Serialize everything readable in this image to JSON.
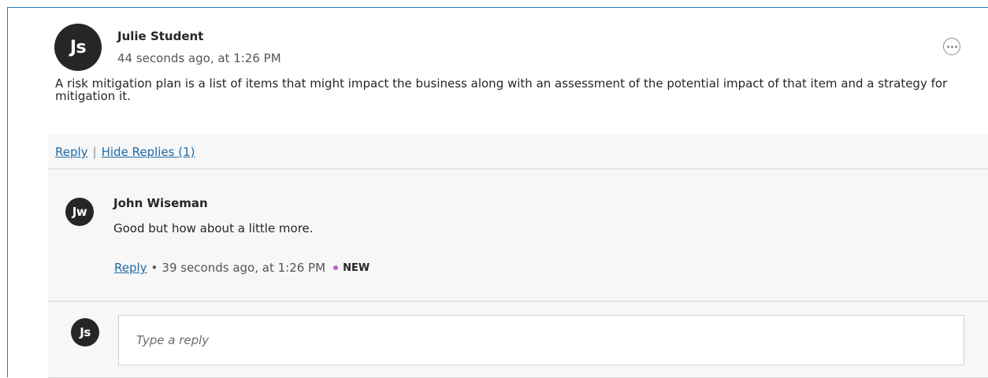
{
  "post": {
    "avatar_initials": "Js",
    "author": "Julie Student",
    "timestamp": "44 seconds ago, at 1:26 PM",
    "body": "A risk mitigation plan is a list of items that might impact the business along with an assessment of the potential impact of that item and a strategy for mitigation it."
  },
  "actions": {
    "reply_label": "Reply",
    "separator": "|",
    "hide_replies_label": "Hide Replies (1)"
  },
  "reply": {
    "avatar_initials": "Jw",
    "author": "John Wiseman",
    "body": "Good but how about a little more.",
    "reply_label": "Reply",
    "bullet": "•",
    "timestamp": "39 seconds ago, at 1:26 PM",
    "new_badge": "NEW"
  },
  "composer": {
    "avatar_initials": "Js",
    "placeholder": "Type a reply"
  },
  "icons": {
    "more": "more-options-icon"
  },
  "colors": {
    "link": "#1f6ba8",
    "frame_border": "#2a77b6",
    "new_dot": "#c25fd0"
  }
}
